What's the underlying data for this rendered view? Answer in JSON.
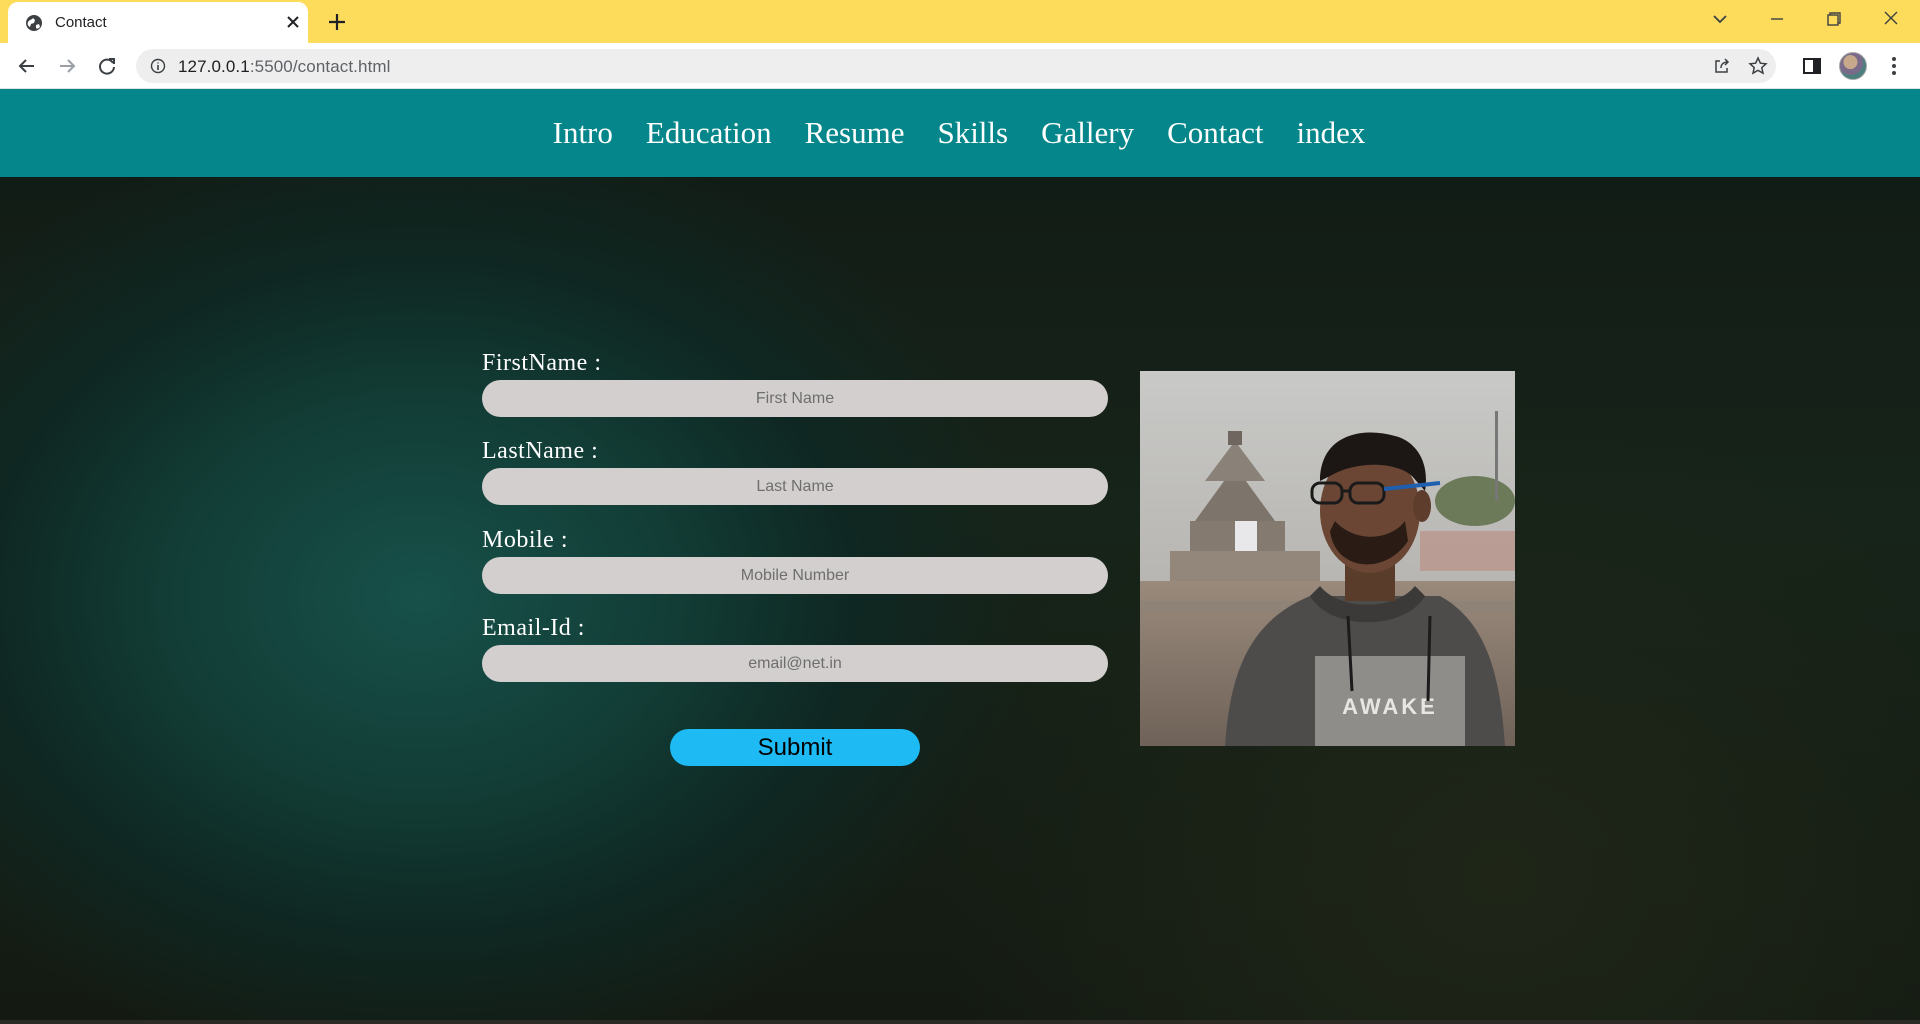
{
  "browser": {
    "tab_title": "Contact",
    "url_host": "127.0.0.1",
    "url_rest": ":5500/contact.html"
  },
  "nav": {
    "links": [
      "Intro",
      "Education",
      "Resume",
      "Skills",
      "Gallery",
      "Contact",
      "index"
    ]
  },
  "form": {
    "fields": [
      {
        "label": "FirstName :",
        "placeholder": "First Name"
      },
      {
        "label": "LastName :",
        "placeholder": "Last Name"
      },
      {
        "label": "Mobile :",
        "placeholder": "Mobile Number"
      },
      {
        "label": "Email-Id :",
        "placeholder": "email@net.in"
      }
    ],
    "submit_label": "Submit"
  },
  "photo": {
    "shirt_text": "AWAKE"
  },
  "colors": {
    "chrome_title": "#fddc5c",
    "nav_bg": "#05868a",
    "input_bg": "#d3cfcf",
    "submit_bg": "#1ebaf3"
  }
}
